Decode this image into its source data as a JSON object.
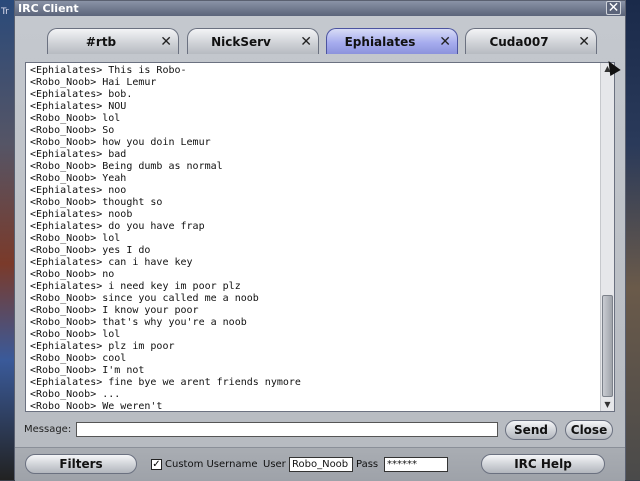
{
  "background": {
    "left_text": "Tr"
  },
  "window": {
    "title": "IRC Client",
    "close_glyph": "✕"
  },
  "tabs": [
    {
      "label": "#rtb",
      "close": "✕",
      "active": false
    },
    {
      "label": "NickServ",
      "close": "✕",
      "active": false
    },
    {
      "label": "Ephialates",
      "close": "✕",
      "active": true
    },
    {
      "label": "Cuda007",
      "close": "✕",
      "active": false
    }
  ],
  "chat": {
    "lines": [
      "<Ephialates> This is Robo-",
      "<Robo_Noob> Hai Lemur",
      "<Ephialates> bob.",
      "<Ephialates> NOU",
      "<Robo_Noob> lol",
      "<Robo_Noob> So",
      "<Robo_Noob> how you doin Lemur",
      "<Ephialates> bad",
      "<Robo_Noob> Being dumb as normal",
      "<Robo_Noob> Yeah",
      "<Ephialates> noo",
      "<Robo_Noob> thought so",
      "<Ephialates> noob",
      "<Ephialates> do you have frap",
      "<Robo_Noob> lol",
      "<Robo_Noob> yes I do",
      "<Ephialates> can i have key",
      "<Robo_Noob> no",
      "<Ephialates> i need key im poor plz",
      "<Robo_Noob> since you called me a noob",
      "<Robo_Noob> I know your poor",
      "<Robo_Noob> that's why you're a noob",
      "<Robo_Noob> lol",
      "<Ephialates> plz im poor",
      "<Robo_Noob> cool",
      "<Robo_Noob> I'm not",
      "<Ephialates> fine bye we arent friends nymore",
      "<Robo_Noob> ...",
      "<Robo_Noob> We weren't"
    ],
    "scroll_up": "▲",
    "scroll_down": "▼"
  },
  "message": {
    "label": "Message:",
    "value": "",
    "send_label": "Send",
    "close_label": "Close"
  },
  "bottom": {
    "filters_label": "Filters",
    "custom_username_label": "Custom Username",
    "custom_username_checked": true,
    "check_glyph": "✓",
    "user_label": "User",
    "user_value": "Robo_Noob",
    "pass_label": "Pass",
    "pass_value": "******",
    "help_label": "IRC Help"
  }
}
